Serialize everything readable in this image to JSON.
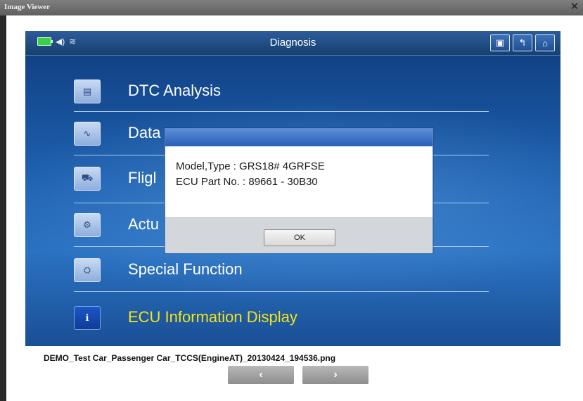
{
  "window": {
    "title": "Image Viewer",
    "close_glyph": "✕"
  },
  "screen": {
    "title": "Diagnosis",
    "status_icons": [
      "battery-icon",
      "speaker-icon",
      "wifi-icon"
    ],
    "toolbar_buttons": [
      {
        "name": "screenshot-icon",
        "glyph": "▣"
      },
      {
        "name": "back-icon",
        "glyph": "↰"
      },
      {
        "name": "home-icon",
        "glyph": "⌂"
      }
    ],
    "menu_items": [
      {
        "label": "DTC Analysis",
        "icon": "engine-icon",
        "glyph": "▤"
      },
      {
        "label": "Data",
        "icon": "data-waveform-icon",
        "glyph": "∿"
      },
      {
        "label": "Fligl",
        "icon": "car-flight-icon",
        "glyph": "⛟"
      },
      {
        "label": "Actu",
        "icon": "actuator-car-icon",
        "glyph": "⚙"
      },
      {
        "label": "Special Function",
        "icon": "special-car-icon",
        "glyph": "⛭"
      },
      {
        "label": "ECU Information Display",
        "icon": "ecu-info-icon",
        "glyph": "ℹ"
      }
    ],
    "selected_item": "ECU Information Display"
  },
  "dialog": {
    "model_line": "Model,Type : GRS18# 4GRFSE",
    "ecu_line": "ECU Part No. : 89661 - 30B30",
    "ok_label": "OK"
  },
  "footer": {
    "filename": "DEMO_Test Car_Passenger Car_TCCS(EngineAT)_20130424_194536.png",
    "prev_glyph": "‹",
    "next_glyph": "›"
  },
  "colors": {
    "screen_blue": "#1d5fae",
    "selected_label": "#f3e514",
    "battery": "#3bd04a"
  }
}
